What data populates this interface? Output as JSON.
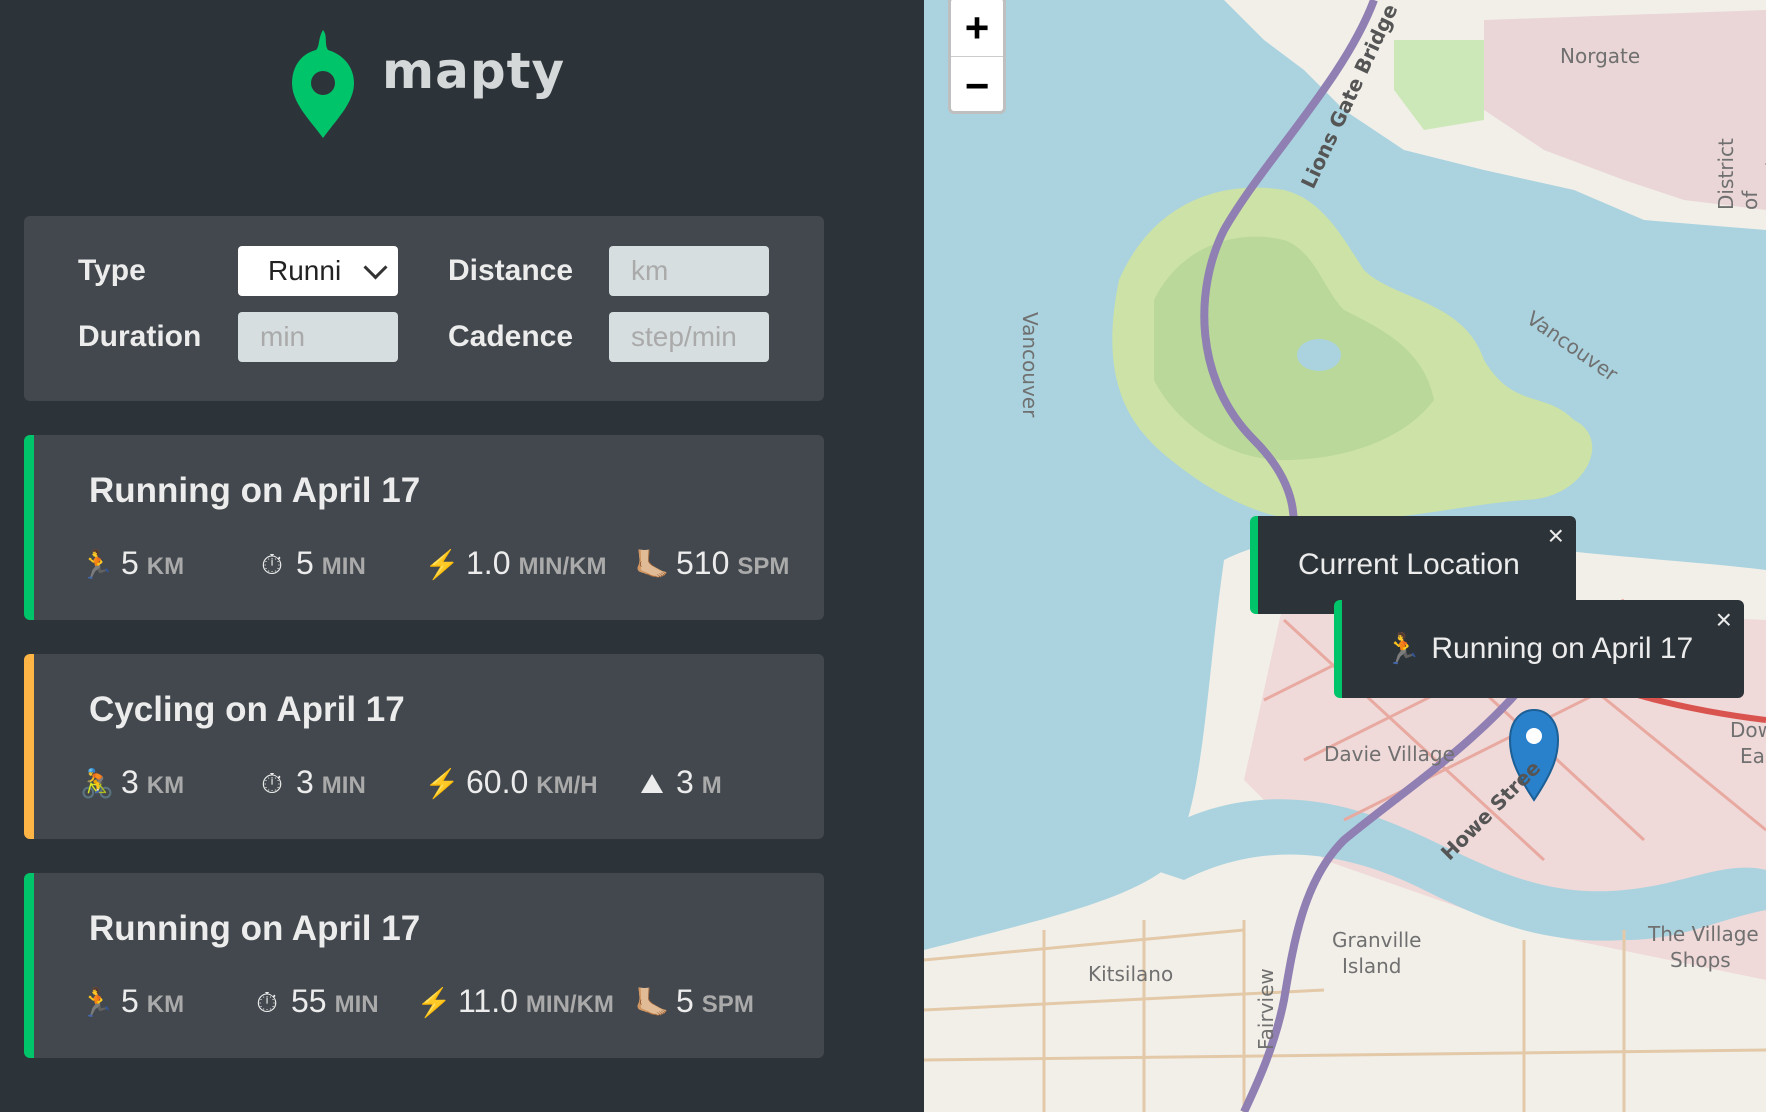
{
  "app": {
    "name": "mapty"
  },
  "form": {
    "type_label": "Type",
    "type_value": "Runni",
    "distance_label": "Distance",
    "distance_placeholder": "km",
    "duration_label": "Duration",
    "duration_placeholder": "min",
    "cadence_label": "Cadence",
    "cadence_placeholder": "step/min"
  },
  "workouts": [
    {
      "kind": "running",
      "title": "Running on April 17",
      "details": [
        {
          "icon": "🏃",
          "value": "5",
          "unit": "km"
        },
        {
          "icon": "⏱",
          "value": "5",
          "unit": "min"
        },
        {
          "icon": "⚡️",
          "value": "1.0",
          "unit": "min/km"
        },
        {
          "icon": "🦶🏼",
          "value": "510",
          "unit": "spm"
        }
      ]
    },
    {
      "kind": "cycling",
      "title": "Cycling on April 17",
      "details": [
        {
          "icon": "🚴",
          "value": "3",
          "unit": "km"
        },
        {
          "icon": "⏱",
          "value": "3",
          "unit": "min"
        },
        {
          "icon": "⚡️",
          "value": "60.0",
          "unit": "km/h"
        },
        {
          "icon": "⛰",
          "value": "3",
          "unit": "m"
        }
      ]
    },
    {
      "kind": "running",
      "title": "Running on April 17",
      "details": [
        {
          "icon": "🏃",
          "value": "5",
          "unit": "km"
        },
        {
          "icon": "⏱",
          "value": "55",
          "unit": "min"
        },
        {
          "icon": "⚡️",
          "value": "11.0",
          "unit": "min/km"
        },
        {
          "icon": "🦶🏼",
          "value": "5",
          "unit": "spm"
        }
      ]
    }
  ],
  "map": {
    "zoom_in": "+",
    "zoom_out": "−",
    "popups": [
      {
        "text": "Current Location",
        "close": "×"
      },
      {
        "icon": "🏃",
        "text": "Running on April 17",
        "close": "×"
      }
    ],
    "labels": {
      "norgate": "Norgate",
      "district": "District of North Vanco",
      "lions_gate": "Lions Gate Bridge",
      "vancouver_v": "Vancouver",
      "vancouver_h": "Vancouver",
      "davie": "Davie Village",
      "howe": "Howe Stree",
      "granville": "Granville",
      "island": "Island",
      "kitsilano": "Kitsilano",
      "fairview": "Fairview",
      "village1": "The Village",
      "village2": "Shops",
      "dow": "Dow",
      "eas": "Eas"
    }
  },
  "colors": {
    "running": "#00c46a",
    "cycling": "#ffb545",
    "sidebar": "#2d3439",
    "card": "#42484d"
  }
}
